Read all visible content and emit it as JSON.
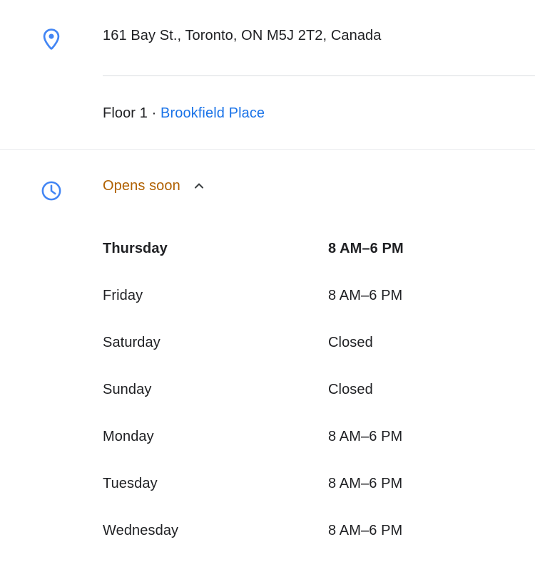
{
  "address": {
    "icon": "map-pin-icon",
    "text": "161 Bay St., Toronto, ON M5J 2T2, Canada"
  },
  "floor": {
    "label": "Floor 1",
    "separator": "·",
    "link_text": "Brookfield Place"
  },
  "hours": {
    "icon": "clock-icon",
    "status": "Opens soon",
    "status_color": "#b06000",
    "toggle_icon": "chevron-up-icon",
    "days": [
      {
        "day": "Thursday",
        "time": "8 AM–6 PM",
        "today": true
      },
      {
        "day": "Friday",
        "time": "8 AM–6 PM",
        "today": false
      },
      {
        "day": "Saturday",
        "time": "Closed",
        "today": false
      },
      {
        "day": "Sunday",
        "time": "Closed",
        "today": false
      },
      {
        "day": "Monday",
        "time": "8 AM–6 PM",
        "today": false
      },
      {
        "day": "Tuesday",
        "time": "8 AM–6 PM",
        "today": false
      },
      {
        "day": "Wednesday",
        "time": "8 AM–6 PM",
        "today": false
      }
    ]
  },
  "colors": {
    "link_blue": "#1a73e8",
    "icon_blue": "#4285f4",
    "text_primary": "#202124",
    "divider": "#dadce0",
    "amber": "#b06000"
  }
}
